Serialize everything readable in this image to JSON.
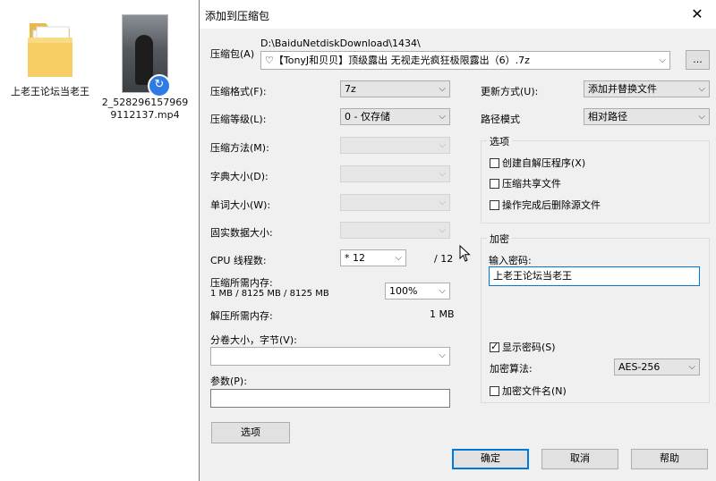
{
  "desktop": {
    "items": [
      {
        "label": "上老王论坛当老王",
        "type": "folder-icon"
      },
      {
        "label": "2_5282961579699112137.mp4",
        "type": "video-file-icon"
      }
    ]
  },
  "dialog": {
    "title": "添加到压缩包",
    "archive_label": "压缩包(A)",
    "archive_path": "D:\\BaiduNetdiskDownload\\1434\\",
    "archive_name": "♡【TonyJ和贝贝】顶级露出 无视走光疯狂极限露出（6）.7z",
    "browse_label": "...",
    "format": {
      "label": "压缩格式(F):",
      "value": "7z"
    },
    "level": {
      "label": "压缩等级(L):",
      "value": "0 - 仅存储"
    },
    "method": {
      "label": "压缩方法(M):",
      "value": ""
    },
    "dict": {
      "label": "字典大小(D):",
      "value": ""
    },
    "word": {
      "label": "单词大小(W):",
      "value": ""
    },
    "solid": {
      "label": "固实数据大小:",
      "value": ""
    },
    "cpu": {
      "label": "CPU 线程数:",
      "value": "* 12",
      "total": "/ 12"
    },
    "mem_compress": {
      "label": "压缩所需内存:",
      "detail": "1 MB / 8125 MB / 8125 MB",
      "percent": "100%"
    },
    "mem_decompress": {
      "label": "解压所需内存:",
      "value": "1 MB"
    },
    "volume": {
      "label": "分卷大小，字节(V):",
      "value": ""
    },
    "params": {
      "label": "参数(P):",
      "value": ""
    },
    "options_button": "选项",
    "update": {
      "label": "更新方式(U):",
      "value": "添加并替换文件"
    },
    "path_mode": {
      "label": "路径模式",
      "value": "相对路径"
    },
    "options_group": {
      "title": "选项",
      "items": [
        {
          "label": "创建自解压程序(X)",
          "checked": false
        },
        {
          "label": "压缩共享文件",
          "checked": false
        },
        {
          "label": "操作完成后删除源文件",
          "checked": false
        }
      ]
    },
    "encryption": {
      "title": "加密",
      "password_label": "输入密码:",
      "password_value": "上老王论坛当老王",
      "show_password": {
        "label": "显示密码(S)",
        "checked": true
      },
      "method_label": "加密算法:",
      "method_value": "AES-256",
      "encrypt_names": {
        "label": "加密文件名(N)",
        "checked": false
      }
    },
    "buttons": {
      "ok": "确定",
      "cancel": "取消",
      "help": "帮助"
    }
  }
}
